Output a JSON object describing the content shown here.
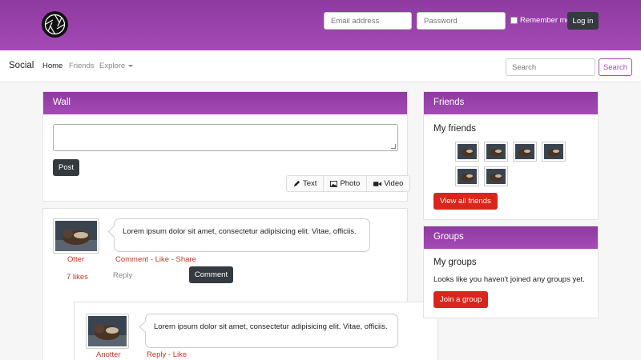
{
  "header": {
    "email_placeholder": "Email address",
    "password_placeholder": "Password",
    "remember_label": "Remember me",
    "login_label": "Log in",
    "accent_color": "#a44ab5"
  },
  "navbar": {
    "brand": "Social",
    "links": [
      "Home",
      "Friends",
      "Explore"
    ],
    "search_placeholder": "Search",
    "search_button": "Search"
  },
  "wall": {
    "title": "Wall",
    "post_button": "Post",
    "post_types": [
      {
        "label": "Text",
        "icon": "pencil-icon"
      },
      {
        "label": "Photo",
        "icon": "image-icon"
      },
      {
        "label": "Video",
        "icon": "video-camera-icon"
      }
    ]
  },
  "post": {
    "author": "Otter",
    "text": "Lorem ipsum dolor sit amet, consectetur adipisicing elit. Vitae, officiis.",
    "actions": [
      "Comment",
      "Like",
      "Share"
    ],
    "likes": "7 likes",
    "reply_placeholder": "Reply",
    "comment_button": "Comment"
  },
  "reply": {
    "author": "Anotter",
    "text": "Lorem ipsum dolor sit amet, consectetur adipisicing elit. Vitae, officiis.",
    "actions": [
      "Reply",
      "Like"
    ]
  },
  "friends": {
    "title": "Friends",
    "subtitle": "My friends",
    "button": "View all friends"
  },
  "groups": {
    "title": "Groups",
    "subtitle": "My groups",
    "text": "Looks like you haven't joined any groups yet.",
    "button": "Join a group"
  }
}
